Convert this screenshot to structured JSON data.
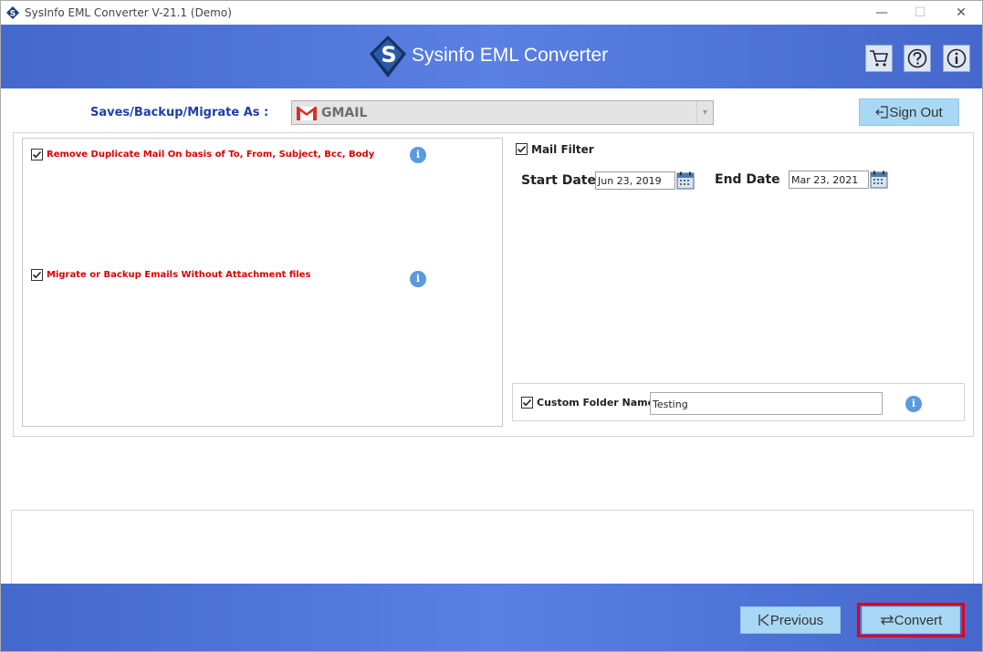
{
  "window": {
    "title": "SysInfo EML Converter V-21.1 (Demo)",
    "controls": {
      "minimize": "—",
      "maximize": "☐",
      "close": "✕"
    }
  },
  "header": {
    "logo_letter": "S",
    "app_title": "Sysinfo EML Converter",
    "buttons": [
      {
        "name": "cart",
        "icon": "cart-icon"
      },
      {
        "name": "help",
        "icon": "help-icon"
      },
      {
        "name": "info",
        "icon": "info-icon"
      }
    ]
  },
  "saves": {
    "label": "Saves/Backup/Migrate As :",
    "selected_format": "GMAIL",
    "format_icon": "gmail-icon"
  },
  "signout": {
    "label": "Sign Out",
    "icon": "sign-out-icon"
  },
  "options": {
    "remove_duplicate": {
      "label": "Remove Duplicate Mail On basis of To, From, Subject, Bcc, Body",
      "checked": true
    },
    "without_attachment": {
      "label": "Migrate or Backup Emails Without Attachment files",
      "checked": true
    },
    "info_glyph": "i"
  },
  "mail_filter": {
    "label": "Mail Filter",
    "checked": true,
    "start_date_label": "Start Date",
    "start_date": "Jun 23, 2019",
    "end_date_label": "End Date",
    "end_date": "Mar 23, 2021"
  },
  "custom_folder": {
    "label": "Custom Folder Name",
    "checked": true,
    "value": "Testing"
  },
  "footer": {
    "previous_label": "Previous",
    "convert_label": "Convert"
  },
  "colors": {
    "header_blue": "#4468cc",
    "button_light_blue": "#a8d8f4",
    "option_red": "#e00000",
    "label_blue": "#1f3fa6",
    "highlight_red": "#e0001a"
  }
}
